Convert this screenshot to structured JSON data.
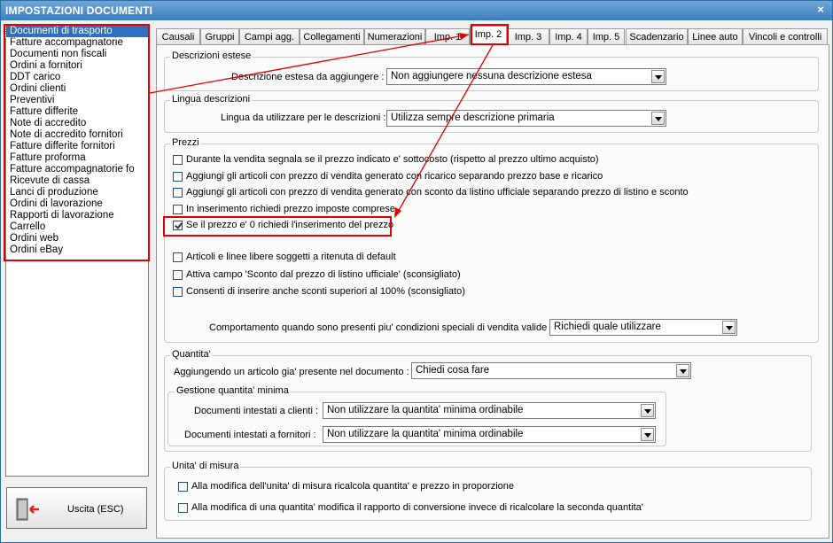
{
  "window": {
    "title": "IMPOSTAZIONI DOCUMENTI",
    "close_label": "×"
  },
  "doclist": {
    "items": [
      "Documenti di trasporto",
      "Fatture accompagnatorie",
      "Documenti non fiscali",
      "Ordini a fornitori",
      "DDT carico",
      "Ordini clienti",
      "Preventivi",
      "Fatture differite",
      "Note di accredito",
      "Note di accredito fornitori",
      "Fatture differite fornitori",
      "Fatture proforma",
      "Fatture accompagnatorie fo",
      "Ricevute di cassa",
      "Lanci di produzione",
      "Ordini di lavorazione",
      "Rapporti di lavorazione",
      "Carrello",
      "Ordini web",
      "Ordini eBay"
    ],
    "selected_index": 0
  },
  "exit_button": {
    "label": "Uscita (ESC)"
  },
  "tabs": [
    "Causali",
    "Gruppi",
    "Campi agg.",
    "Collegamenti",
    "Numerazioni",
    "Imp. 1",
    "Imp. 2",
    "Imp. 3",
    "Imp. 4",
    "Imp. 5",
    "Scadenzario",
    "Linee auto",
    "Vincoli e controlli"
  ],
  "active_tab": "Imp. 2",
  "descrizioni": {
    "group_label": "Descrizioni estese",
    "field_label": "Descrizione estesa da aggiungere :",
    "value": "Non aggiungere nessuna descrizione estesa"
  },
  "lingua": {
    "group_label": "Lingua descrizioni",
    "field_label": "Lingua da utilizzare per le descrizioni :",
    "value": "Utilizza sempre descrizione primaria"
  },
  "prezzi": {
    "group_label": "Prezzi",
    "checks": [
      {
        "label": "Durante la vendita segnala se il prezzo indicato e' sottocosto (rispetto al prezzo ultimo acquisto)",
        "checked": false
      },
      {
        "label": "Aggiungi gli articoli con prezzo di vendita generato con ricarico separando prezzo base e ricarico",
        "checked": false
      },
      {
        "label": "Aggiungi gli articoli con prezzo di vendita generato con sconto da listino ufficiale separando prezzo di listino e sconto",
        "checked": false
      },
      {
        "label": "In inserimento richiedi prezzo imposte comprese",
        "checked": false
      },
      {
        "label": "Se il prezzo e' 0 richiedi l'inserimento del prezzo",
        "checked": true
      },
      {
        "label": "Articoli e linee libere soggetti a ritenuta di default",
        "checked": false
      },
      {
        "label": "Attiva campo 'Sconto dal prezzo di listino ufficiale' (sconsigliato)",
        "checked": false
      },
      {
        "label": "Consenti di inserire anche sconti superiori al 100% (sconsigliato)",
        "checked": false
      }
    ],
    "field_label": "Comportamento quando sono presenti piu' condizioni speciali di vendita valide :",
    "value": "Richiedi quale utilizzare"
  },
  "quantita": {
    "group_label": "Quantita'",
    "field_label": "Aggiungendo un articolo gia' presente nel documento :",
    "value": "Chiedi cosa fare",
    "min_group_label": "Gestione quantita' minima",
    "clienti_label": "Documenti intestati a clienti :",
    "clienti_value": "Non utilizzare la quantita' minima ordinabile",
    "fornitori_label": "Documenti intestati a fornitori :",
    "fornitori_value": "Non utilizzare la quantita' minima ordinabile"
  },
  "unita": {
    "group_label": "Unita' di misura",
    "checks": [
      {
        "label": "Alla modifica dell'unita' di misura ricalcola quantita' e prezzo in proporzione",
        "checked": false
      },
      {
        "label": "Alla modifica di una quantita' modifica il rapporto di conversione invece di ricalcolare la seconda quantita'",
        "checked": false
      }
    ]
  },
  "colors": {
    "highlight": "#e00000",
    "selection": "#2f6fbf",
    "titlebar": "#3c7fbe"
  }
}
